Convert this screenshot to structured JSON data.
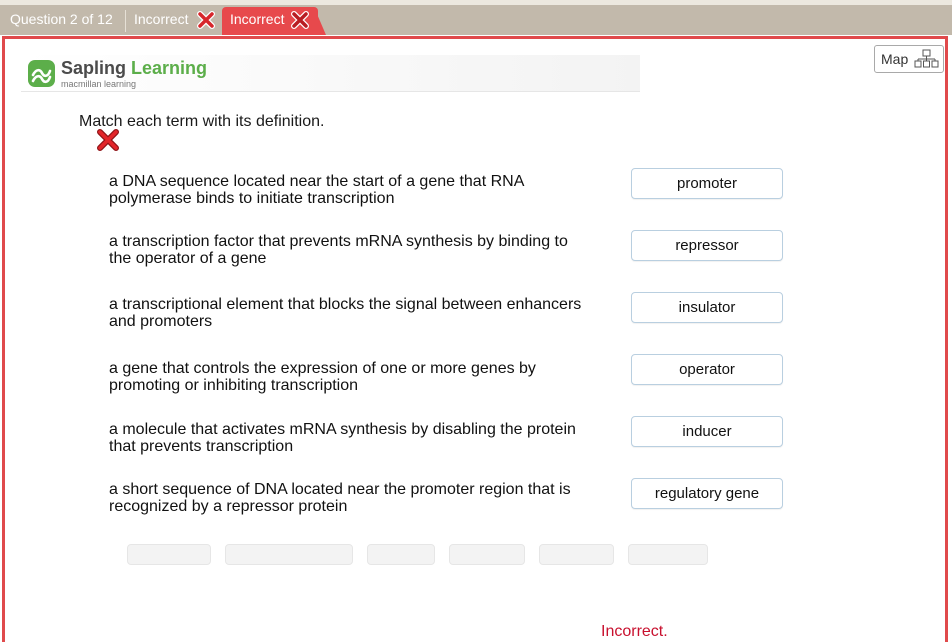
{
  "header": {
    "question_label": "Question 2 of 12",
    "previous_attempt": {
      "label": "Incorrect",
      "status_icon": "red-x-icon"
    },
    "current_attempt": {
      "label": "Incorrect",
      "status_icon": "red-x-icon"
    }
  },
  "toolbar": {
    "map_label": "Map",
    "map_icon": "sitemap-icon"
  },
  "brand": {
    "name_part1": "Sapling",
    "name_part2": "Learning",
    "tagline": "macmillan learning",
    "accent_color": "#5cae4a"
  },
  "question": {
    "prompt": "Match each term with its definition.",
    "result_icon": "red-x-icon"
  },
  "pairs": [
    {
      "definition": "a DNA sequence located near the start of a gene that RNA polymerase binds to initiate transcription",
      "answer": "promoter"
    },
    {
      "definition": "a transcription factor that prevents mRNA synthesis by binding to the operator of a gene",
      "answer": "repressor"
    },
    {
      "definition": "a transcriptional element that blocks the signal between enhancers and promoters",
      "answer": "insulator"
    },
    {
      "definition": "a gene that controls the expression of one or more genes by promoting or inhibiting transcription",
      "answer": "operator"
    },
    {
      "definition": "a molecule that activates mRNA synthesis by disabling the protein that prevents transcription",
      "answer": "inducer"
    },
    {
      "definition": "a short sequence of DNA located near the promoter region that is recognized by a repressor protein",
      "answer": "regulatory gene"
    }
  ],
  "feedback": {
    "text": "Incorrect.",
    "color": "#c8102e"
  },
  "colors": {
    "incorrect_tab": "#e7494c",
    "frame_border": "#e04a4c",
    "tab_bar": "#c2b9ab"
  }
}
